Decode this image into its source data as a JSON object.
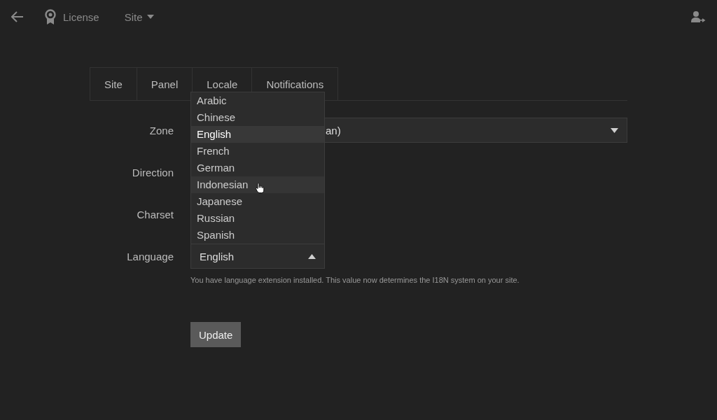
{
  "topbar": {
    "title": "License",
    "menu": "Site"
  },
  "tabs": [
    {
      "label": "Site"
    },
    {
      "label": "Panel"
    },
    {
      "label": "Locale"
    },
    {
      "label": "Notifications"
    }
  ],
  "form": {
    "zone": {
      "label": "Zone",
      "value": "an)"
    },
    "direction": {
      "label": "Direction"
    },
    "charset": {
      "label": "Charset"
    },
    "language": {
      "label": "Language",
      "value": "English",
      "expanded": true,
      "options": [
        {
          "label": "Arabic",
          "selected": false,
          "hovered": false
        },
        {
          "label": "Chinese",
          "selected": false,
          "hovered": false
        },
        {
          "label": "English",
          "selected": true,
          "hovered": false
        },
        {
          "label": "French",
          "selected": false,
          "hovered": false
        },
        {
          "label": "German",
          "selected": false,
          "hovered": false
        },
        {
          "label": "Indonesian",
          "selected": false,
          "hovered": true
        },
        {
          "label": "Japanese",
          "selected": false,
          "hovered": false
        },
        {
          "label": "Russian",
          "selected": false,
          "hovered": false
        },
        {
          "label": "Spanish",
          "selected": false,
          "hovered": false
        }
      ],
      "help": "You have language extension installed. This value now determines the I18N system on your site."
    }
  },
  "update_button": "Update"
}
